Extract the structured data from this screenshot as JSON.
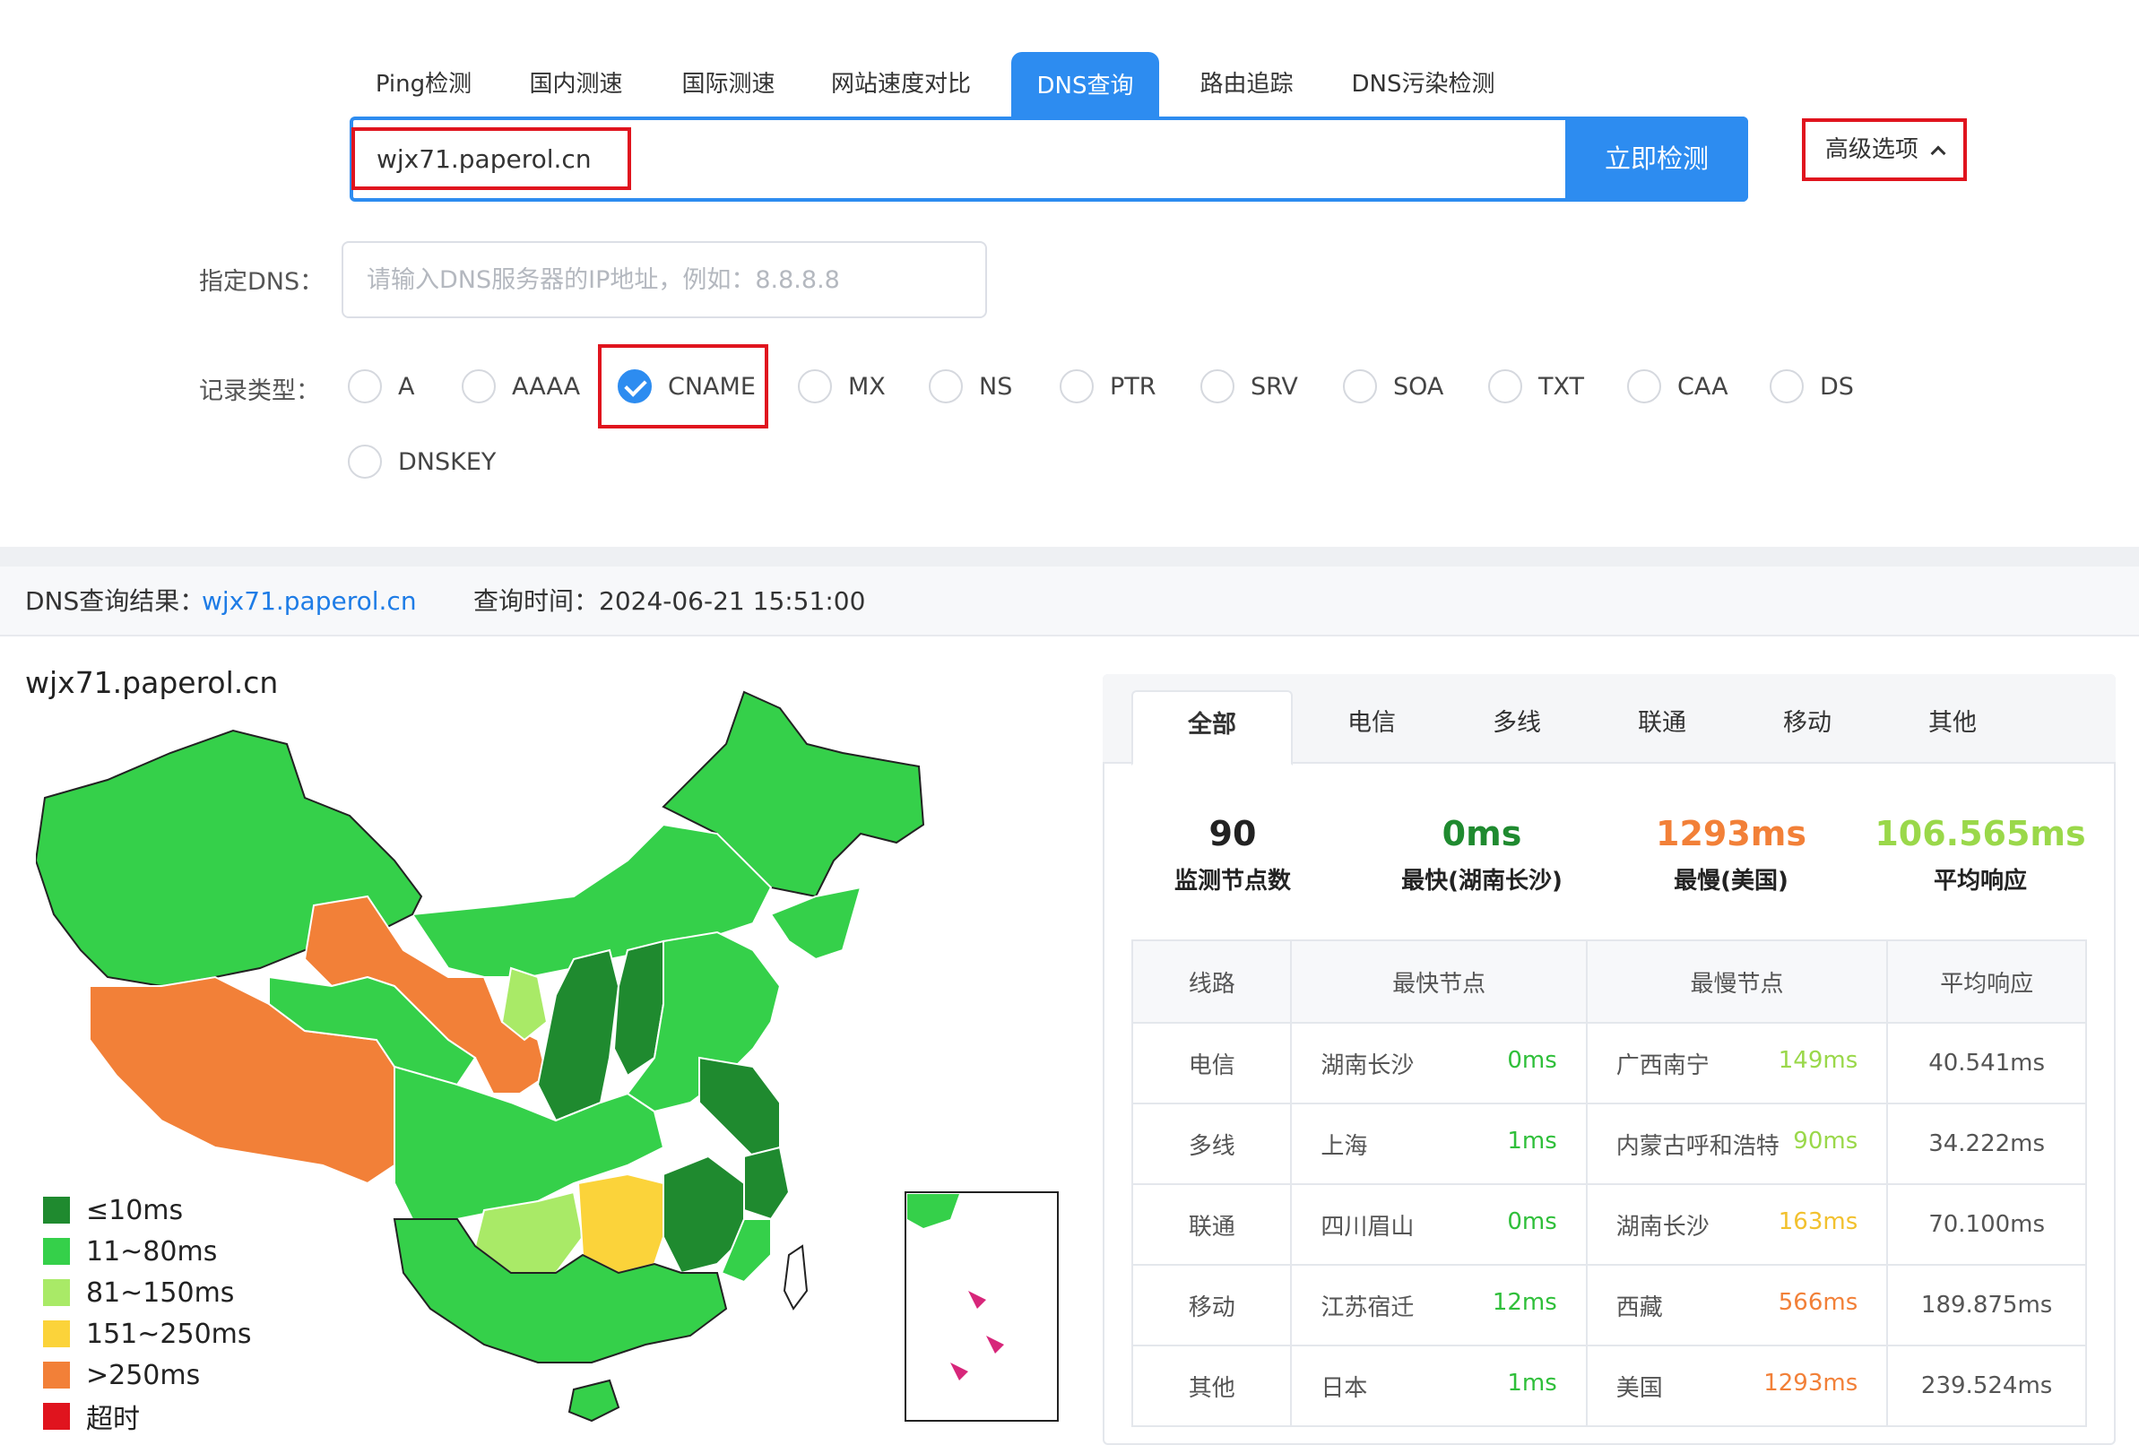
{
  "tabs": [
    {
      "label": "Ping检测"
    },
    {
      "label": "国内测速"
    },
    {
      "label": "国际测速"
    },
    {
      "label": "网站速度对比"
    },
    {
      "label": "DNS查询"
    },
    {
      "label": "路由追踪"
    },
    {
      "label": "DNS污染检测"
    }
  ],
  "search": {
    "value": "wjx71.paperol.cn",
    "button": "立即检测",
    "advanced": "高级选项"
  },
  "dns": {
    "label": "指定DNS：",
    "placeholder": "请输入DNS服务器的IP地址，例如：8.8.8.8"
  },
  "record": {
    "label": "记录类型：",
    "options": [
      "A",
      "AAAA",
      "CNAME",
      "MX",
      "NS",
      "PTR",
      "SRV",
      "SOA",
      "TXT",
      "CAA",
      "DS",
      "DNSKEY"
    ],
    "selected": "CNAME"
  },
  "result": {
    "prefix": "DNS查询结果：",
    "domain": "wjx71.paperol.cn",
    "time_label": "查询时间：",
    "time": "2024-06-21 15:51:00"
  },
  "map_title": "wjx71.paperol.cn",
  "legend": [
    {
      "label": "≤10ms",
      "color": "#1f8a2f"
    },
    {
      "label": "11~80ms",
      "color": "#35d04a"
    },
    {
      "label": "81~150ms",
      "color": "#a9ea67"
    },
    {
      "label": "151~250ms",
      "color": "#fbd33a"
    },
    {
      "label": ">250ms",
      "color": "#f28038"
    },
    {
      "label": "超时",
      "color": "#e0141e"
    }
  ],
  "panel_tabs": [
    "全部",
    "电信",
    "多线",
    "联通",
    "移动",
    "其他"
  ],
  "stats": [
    {
      "value": "90",
      "label": "监测节点数",
      "color": "#222222"
    },
    {
      "value": "0ms",
      "label": "最快(湖南长沙)",
      "color": "#1f8a2f"
    },
    {
      "value": "1293ms",
      "label": "最慢(美国)",
      "color": "#f28038"
    },
    {
      "value": "106.565ms",
      "label": "平均响应",
      "color": "#9ad84a"
    }
  ],
  "table": {
    "headers": [
      "线路",
      "最快节点",
      "最慢节点",
      "平均响应"
    ],
    "rows": [
      {
        "line": "电信",
        "fast": "湖南长沙",
        "fast_ms": "0ms",
        "slow": "广西南宁",
        "slow_ms": "149ms",
        "avg": "40.541ms"
      },
      {
        "line": "多线",
        "fast": "上海",
        "fast_ms": "1ms",
        "slow": "内蒙古呼和浩特",
        "slow_ms": "90ms",
        "avg": "34.222ms"
      },
      {
        "line": "联通",
        "fast": "四川眉山",
        "fast_ms": "0ms",
        "slow": "湖南长沙",
        "slow_ms": "163ms",
        "avg": "70.100ms"
      },
      {
        "line": "移动",
        "fast": "江苏宿迁",
        "fast_ms": "12ms",
        "slow": "西藏",
        "slow_ms": "566ms",
        "avg": "189.875ms"
      },
      {
        "line": "其他",
        "fast": "日本",
        "fast_ms": "1ms",
        "slow": "美国",
        "slow_ms": "1293ms",
        "avg": "239.524ms"
      }
    ]
  }
}
